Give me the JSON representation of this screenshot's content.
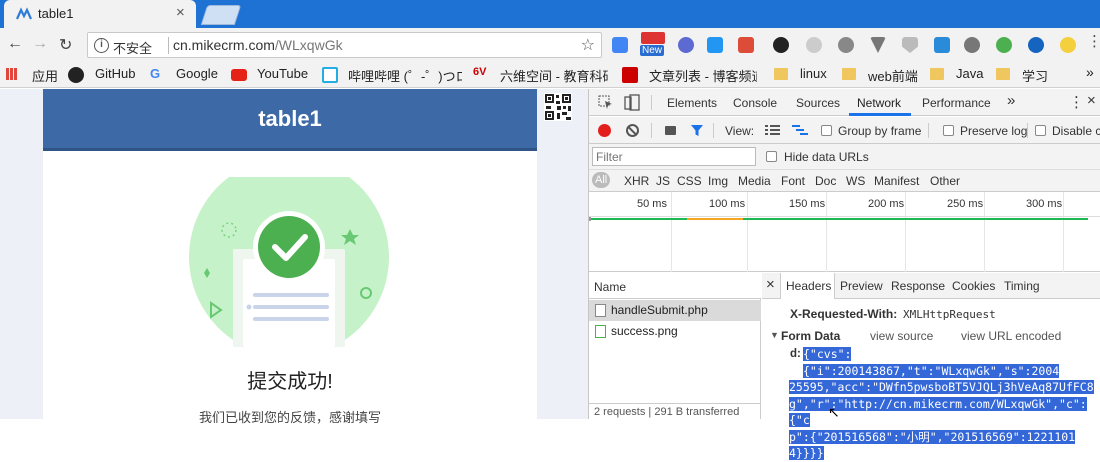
{
  "tab": {
    "title": "table1"
  },
  "address": {
    "security": "不安全",
    "host": "cn.mikecrm.com",
    "path": "/WLxqwGk"
  },
  "extensions": {
    "new_badge": "New"
  },
  "bookmarks": [
    {
      "label": "应用"
    },
    {
      "label": "GitHub"
    },
    {
      "label": "Google"
    },
    {
      "label": "YouTube"
    },
    {
      "label": "哔哩哔哩 (゜-゜)つロ"
    },
    {
      "label": "六维空间 - 教育科研"
    },
    {
      "label": "文章列表 - 博客频道"
    },
    {
      "label": "linux"
    },
    {
      "label": "web前端"
    },
    {
      "label": "Java"
    },
    {
      "label": "学习"
    }
  ],
  "page": {
    "card_title": "table1",
    "success_title": "提交成功!",
    "success_msg": "我们已收到您的反馈，感谢填写"
  },
  "devtools": {
    "tabs": [
      "Elements",
      "Console",
      "Sources",
      "Network",
      "Performance"
    ],
    "active_tab": "Network",
    "view_label": "View:",
    "group_by_frame": "Group by frame",
    "preserve_log": "Preserve log",
    "disable_cache": "Disable c",
    "filter_placeholder": "Filter",
    "hide_data_urls": "Hide data URLs",
    "types": [
      "All",
      "XHR",
      "JS",
      "CSS",
      "Img",
      "Media",
      "Font",
      "Doc",
      "WS",
      "Manifest",
      "Other"
    ],
    "timeline_ticks": [
      "50 ms",
      "100 ms",
      "150 ms",
      "200 ms",
      "250 ms",
      "300 ms"
    ],
    "name_header": "Name",
    "requests": [
      {
        "name": "handleSubmit.php"
      },
      {
        "name": "success.png"
      }
    ],
    "footer": "2 requests | 291 B transferred",
    "detail_tabs": [
      "Headers",
      "Preview",
      "Response",
      "Cookies",
      "Timing"
    ],
    "detail_active": "Headers",
    "xrw_key": "X-Requested-With:",
    "xrw_val": "XMLHttpRequest",
    "form_data_label": "Form Data",
    "view_source": "view source",
    "view_url_encoded": "view URL encoded",
    "form_key": "d:",
    "form_value_lines": [
      "{\"cvs\":{\"i\":200143867,\"t\":\"WLxqwGk\",\"s\":2004",
      "25595,\"acc\":\"DWfn5pwsboBT5VJQLj3hVeAq87UfFC8",
      "g\",\"r\":\"http://cn.mikecrm.com/WLxqwGk\",\"c\":{\"c",
      "p\":{\"201516568\":\"小明\",\"201516569\":1221101",
      "4}}}}"
    ]
  }
}
